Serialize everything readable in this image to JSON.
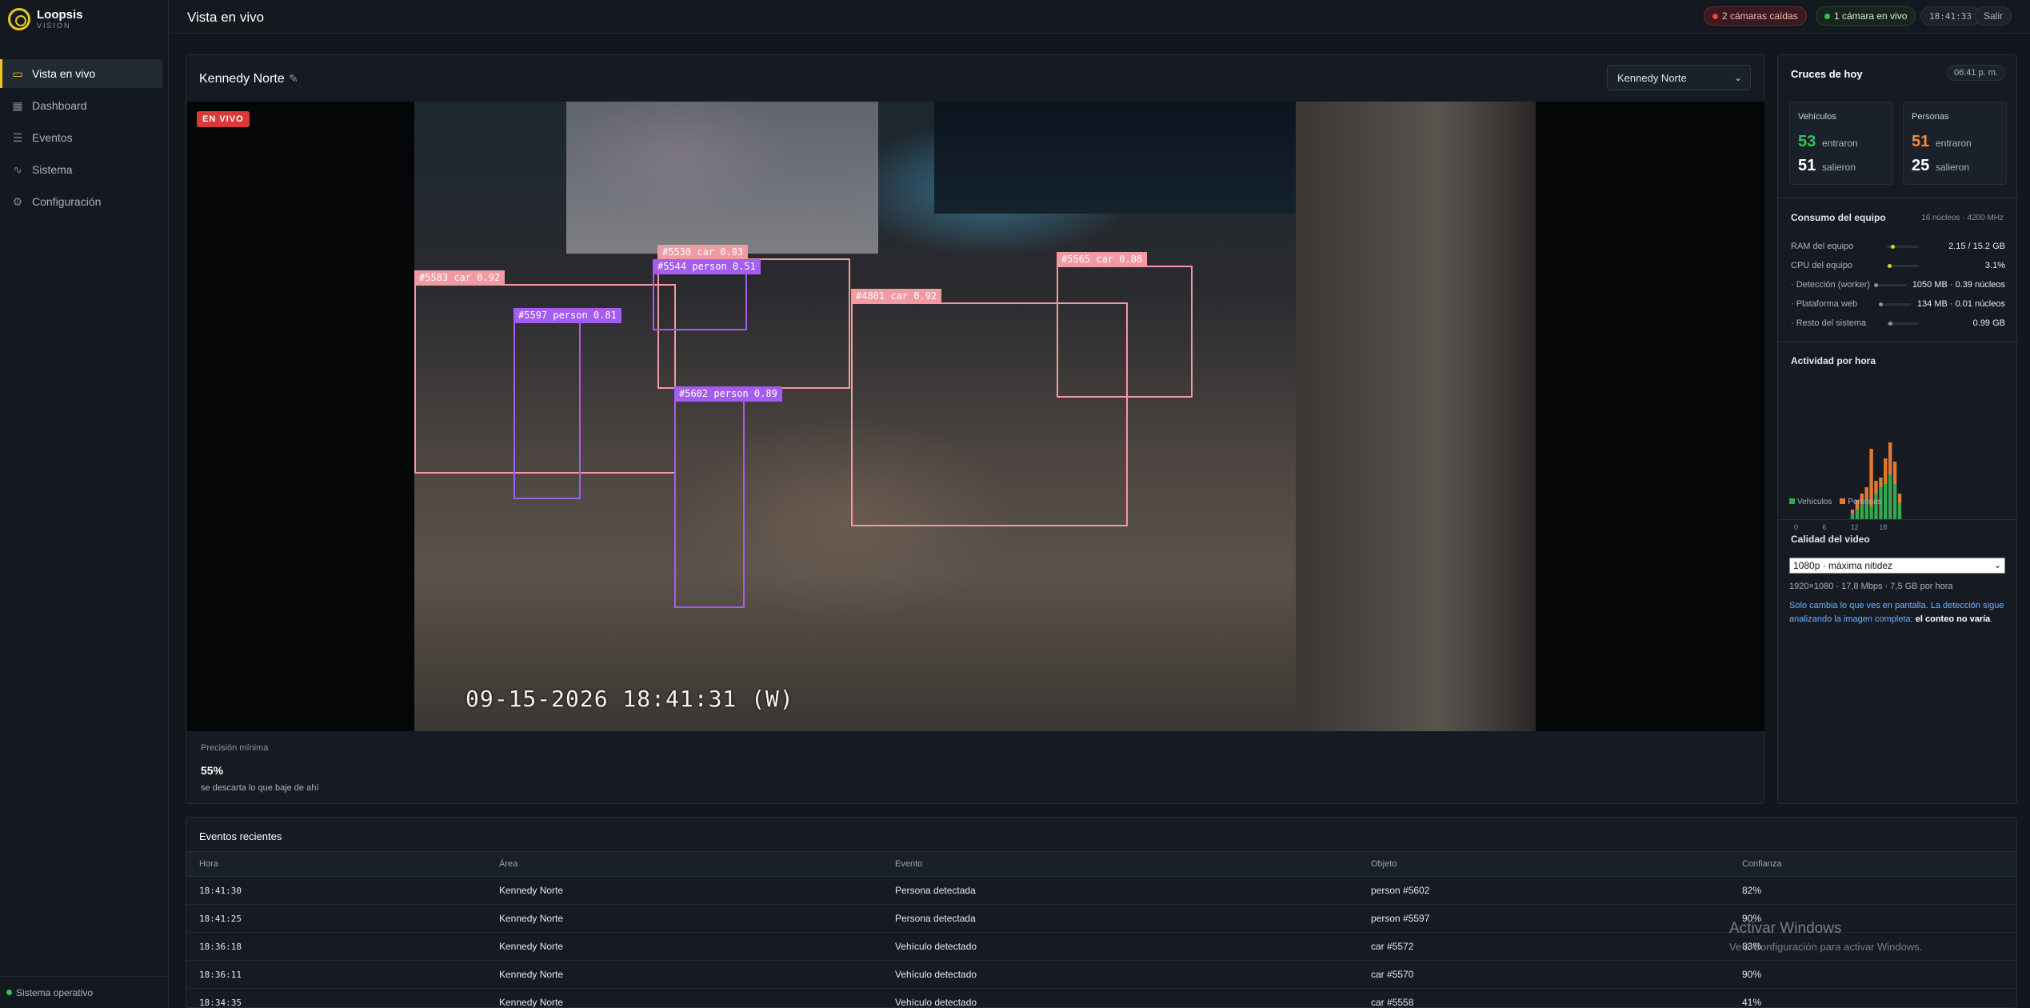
{
  "brand": {
    "name": "Loopsis",
    "tagline": "VISION"
  },
  "nav": [
    {
      "label": "Vista en vivo",
      "icon": "camera-icon",
      "active": true
    },
    {
      "label": "Dashboard",
      "icon": "dashboard-icon"
    },
    {
      "label": "Eventos",
      "icon": "list-icon"
    },
    {
      "label": "Sistema",
      "icon": "pulse-icon"
    },
    {
      "label": "Configuración",
      "icon": "gear-icon"
    }
  ],
  "sidebar_footer": {
    "status": "Sistema operativo"
  },
  "topbar": {
    "title": "Vista en vivo",
    "cameras_down": "2 cámaras caídas",
    "cameras_live": "1 cámara en vivo",
    "clock": "18:41:33",
    "exit_label": "Salir"
  },
  "camera": {
    "name": "Kennedy Norte",
    "selected": "Kennedy Norte",
    "live_badge": "EN VIVO",
    "timestamp": "09-15-2026 18:41:31 (W)",
    "detections": [
      {
        "label": "#5583 car 0.92",
        "kind": "car"
      },
      {
        "label": "#5597 person 0.81",
        "kind": "person"
      },
      {
        "label": "#5530 car 0.93",
        "kind": "car"
      },
      {
        "label": "#5544 person 0.51",
        "kind": "person"
      },
      {
        "label": "#5602 person 0.89",
        "kind": "person"
      },
      {
        "label": "#4801 car 0.92",
        "kind": "car"
      },
      {
        "label": "#5565 car 0.88",
        "kind": "car"
      }
    ],
    "precision": {
      "label": "Precisión mínima",
      "value": "55%",
      "hint": "se descarta lo que baje de ahí"
    }
  },
  "crossings": {
    "title": "Cruces de hoy",
    "time": "06:41 p. m.",
    "vehicles": {
      "label": "Vehículos",
      "in": "53",
      "in_label": "entraron",
      "out": "51",
      "out_label": "salieron"
    },
    "people": {
      "label": "Personas",
      "in": "51",
      "in_label": "entraron",
      "out": "25",
      "out_label": "salieron"
    }
  },
  "resources": {
    "title": "Consumo del equipo",
    "subtitle": "16 núcleos · 4200 MHz",
    "rows": [
      {
        "label": "RAM del equipo",
        "value": "2.15 / 15.2 GB",
        "level": 0.14,
        "color": "#e8d019"
      },
      {
        "label": "CPU del equipo",
        "value": "3.1%",
        "level": 0.03,
        "color": "#e8d019"
      },
      {
        "label": "· Detección (worker)",
        "value": "1050 MB · 0.39 núcleos",
        "level": 0,
        "color": "#8a93a0"
      },
      {
        "label": "· Plataforma web",
        "value": "134 MB · 0.01 núcleos",
        "level": 0,
        "color": "#8a93a0"
      },
      {
        "label": "· Resto del sistema",
        "value": "0.99 GB",
        "level": 0.05,
        "color": "#8a93a0"
      }
    ]
  },
  "activity": {
    "title": "Actividad por hora",
    "legend_vehicles": "Vehículos",
    "legend_people": "Personas",
    "colors": {
      "vehicles": "#35a84e",
      "people": "#e07a32"
    }
  },
  "chart_data": {
    "type": "bar",
    "x": [
      0,
      1,
      2,
      3,
      4,
      5,
      6,
      7,
      8,
      9,
      10,
      11,
      12,
      13,
      14,
      15,
      16,
      17,
      18,
      19,
      20,
      21,
      22,
      23
    ],
    "x_tick_labels": [
      "0",
      "6",
      "12",
      "18"
    ],
    "series": [
      {
        "name": "Vehículos",
        "values": [
          0,
          0,
          0,
          0,
          0,
          0,
          0,
          0,
          0,
          0,
          0,
          0,
          2,
          3,
          5,
          6,
          4,
          8,
          10,
          11,
          14,
          11,
          5,
          0
        ]
      },
      {
        "name": "Personas",
        "values": [
          0,
          0,
          0,
          0,
          0,
          0,
          0,
          0,
          0,
          0,
          0,
          0,
          1,
          3,
          3,
          4,
          18,
          4,
          3,
          8,
          10,
          7,
          3,
          0
        ]
      }
    ],
    "stacked": true
  },
  "video_quality": {
    "title": "Calidad del video",
    "selected": "1080p · máxima nitidez",
    "meta": "1920×1080 · 17,8 Mbps · 7,5 GB por hora",
    "note": "Solo cambia lo que ves en pantalla. La detección sigue analizando la imagen completa: ",
    "note_bold": "el conteo no varía",
    "note_end": "."
  },
  "events": {
    "title": "Eventos recientes",
    "columns": [
      "Hora",
      "Área",
      "Evento",
      "Objeto",
      "Confianza"
    ],
    "rows": [
      [
        "18:41:30",
        "Kennedy Norte",
        "Persona detectada",
        "person #5602",
        "82%"
      ],
      [
        "18:41:25",
        "Kennedy Norte",
        "Persona detectada",
        "person #5597",
        "90%"
      ],
      [
        "18:36:18",
        "Kennedy Norte",
        "Vehículo detectado",
        "car #5572",
        "83%"
      ],
      [
        "18:36:11",
        "Kennedy Norte",
        "Vehículo detectado",
        "car #5570",
        "90%"
      ],
      [
        "18:34:35",
        "Kennedy Norte",
        "Vehículo detectado",
        "car #5558",
        "41%"
      ]
    ]
  },
  "watermark": {
    "line1": "Activar Windows",
    "line2": "Ve a Configuración para activar Windows."
  }
}
